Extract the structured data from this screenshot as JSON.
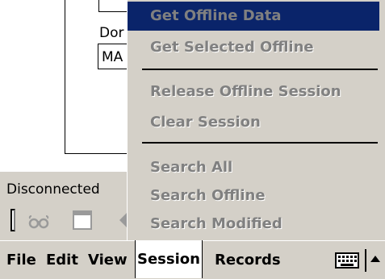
{
  "form": {
    "domain_label": "Dor",
    "domain_value": "MA"
  },
  "status": {
    "text": "Disconnected"
  },
  "toolbar": {
    "icons": [
      "glasses-icon",
      "page-icon",
      "back-arrow-icon"
    ]
  },
  "menubar": {
    "items": [
      "File",
      "Edit",
      "View",
      "Session",
      "Records"
    ],
    "active": "Session"
  },
  "session_menu": {
    "items": [
      {
        "label": "Get Offline Data",
        "highlighted": true,
        "enabled": false
      },
      {
        "label": "Get Selected Offline",
        "highlighted": false,
        "enabled": false
      },
      {
        "label": "Release Offline Session",
        "highlighted": false,
        "enabled": false
      },
      {
        "label": "Clear Session",
        "highlighted": false,
        "enabled": false
      },
      {
        "label": "Search All",
        "highlighted": false,
        "enabled": false
      },
      {
        "label": "Search Offline",
        "highlighted": false,
        "enabled": false
      },
      {
        "label": "Search Modified",
        "highlighted": false,
        "enabled": false
      }
    ]
  },
  "colors": {
    "menu_bg": "#d4d0c8",
    "highlight": "#0a246a",
    "disabled_text": "#808080"
  }
}
